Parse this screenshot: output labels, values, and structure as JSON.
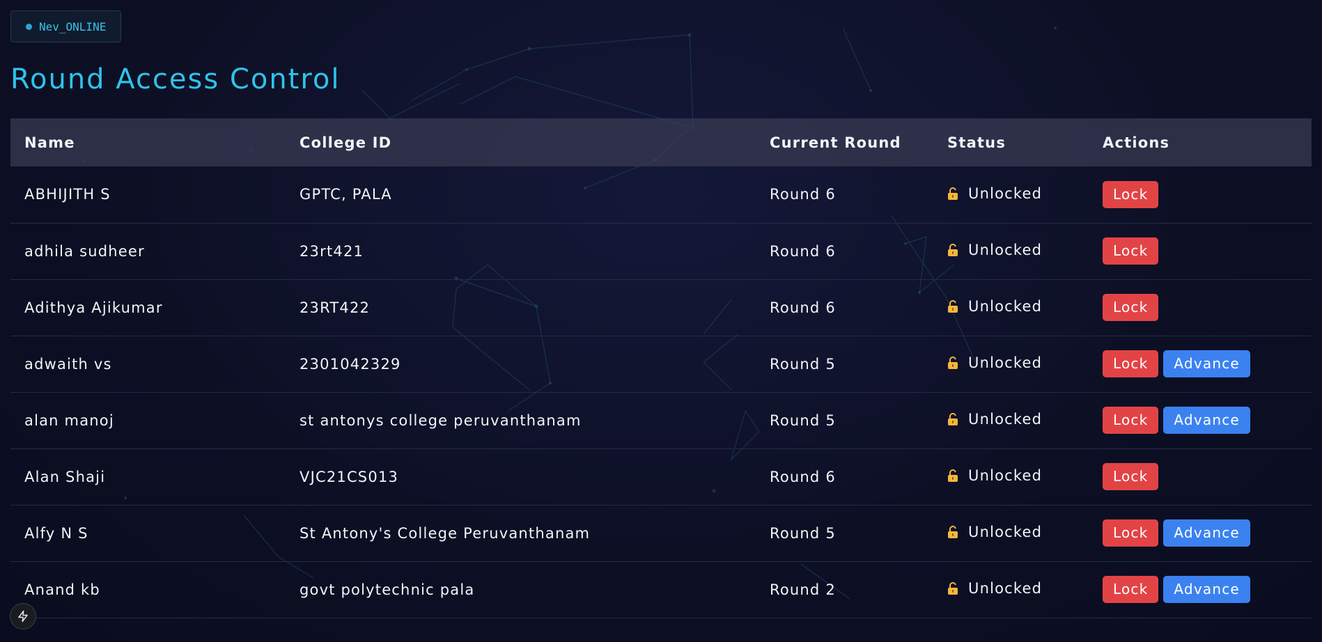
{
  "status_chip": {
    "icon": "status-dot-icon",
    "label": "Nev_ONLINE",
    "color": "#26a8cc"
  },
  "page": {
    "title": "Round Access Control"
  },
  "table": {
    "headers": [
      "Name",
      "College ID",
      "Current Round",
      "Status",
      "Actions"
    ],
    "rows": [
      {
        "name": "ABHIJITH S",
        "college_id": "GPTC, PALA",
        "round": "Round 6",
        "status": "Unlocked",
        "status_icon": "unlocked-padlock-icon",
        "actions": [
          "Lock"
        ]
      },
      {
        "name": "adhila sudheer",
        "college_id": "23rt421",
        "round": "Round 6",
        "status": "Unlocked",
        "status_icon": "unlocked-padlock-icon",
        "actions": [
          "Lock"
        ]
      },
      {
        "name": "Adithya Ajikumar",
        "college_id": "23RT422",
        "round": "Round 6",
        "status": "Unlocked",
        "status_icon": "unlocked-padlock-icon",
        "actions": [
          "Lock"
        ]
      },
      {
        "name": "adwaith vs",
        "college_id": "2301042329",
        "round": "Round 5",
        "status": "Unlocked",
        "status_icon": "unlocked-padlock-icon",
        "actions": [
          "Lock",
          "Advance"
        ]
      },
      {
        "name": "alan manoj",
        "college_id": "st antonys college peruvanthanam",
        "round": "Round 5",
        "status": "Unlocked",
        "status_icon": "unlocked-padlock-icon",
        "actions": [
          "Lock",
          "Advance"
        ]
      },
      {
        "name": "Alan Shaji",
        "college_id": "VJC21CS013",
        "round": "Round 6",
        "status": "Unlocked",
        "status_icon": "unlocked-padlock-icon",
        "actions": [
          "Lock"
        ]
      },
      {
        "name": "Alfy N S",
        "college_id": "St Antony's College Peruvanthanam",
        "round": "Round 5",
        "status": "Unlocked",
        "status_icon": "unlocked-padlock-icon",
        "actions": [
          "Lock",
          "Advance"
        ]
      },
      {
        "name": "Anand kb",
        "college_id": "govt polytechnic pala",
        "round": "Round 2",
        "status": "Unlocked",
        "status_icon": "unlocked-padlock-icon",
        "actions": [
          "Lock",
          "Advance"
        ]
      }
    ]
  },
  "fab": {
    "icon": "lightning-bolt-icon"
  },
  "colors": {
    "accent": "#2fc3ea",
    "lock_button": "#e24446",
    "advance_button": "#3b82f0",
    "background": "#0e1128",
    "header_row": "#3a3c54"
  }
}
